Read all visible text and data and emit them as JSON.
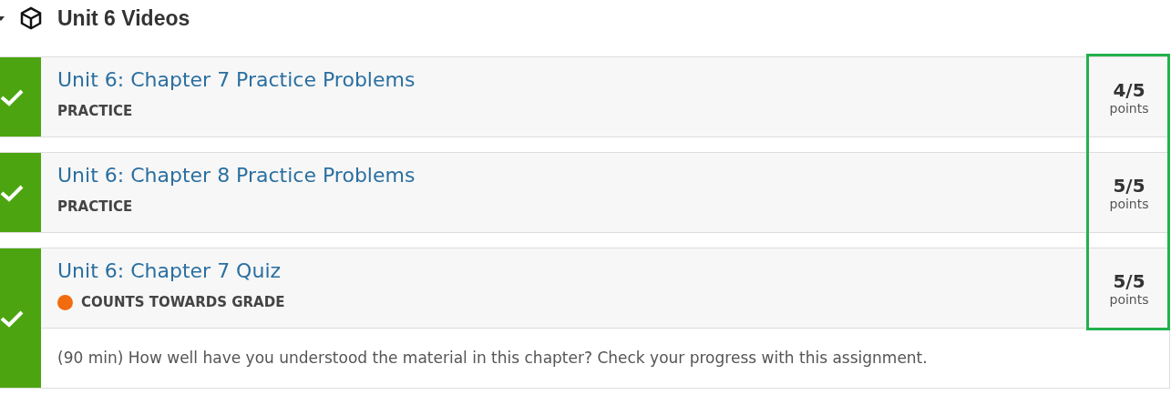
{
  "section": {
    "title": "Unit 6 Videos",
    "expanded": true
  },
  "items": [
    {
      "title": "Unit 6: Chapter 7 Practice Problems",
      "kind": "practice",
      "tag": "PRACTICE",
      "completed": true,
      "score": "4/5",
      "score_unit": "points"
    },
    {
      "title": "Unit 6: Chapter 8 Practice Problems",
      "kind": "practice",
      "tag": "PRACTICE",
      "completed": true,
      "score": "5/5",
      "score_unit": "points"
    },
    {
      "title": "Unit 6: Chapter 7 Quiz",
      "kind": "graded",
      "tag": "COUNTS TOWARDS GRADE",
      "color": "#f26b0f",
      "completed": true,
      "score": "5/5",
      "score_unit": "points",
      "description": "(90 min) How well have you understood the material in this chapter? Check your progress with this assignment."
    }
  ]
}
